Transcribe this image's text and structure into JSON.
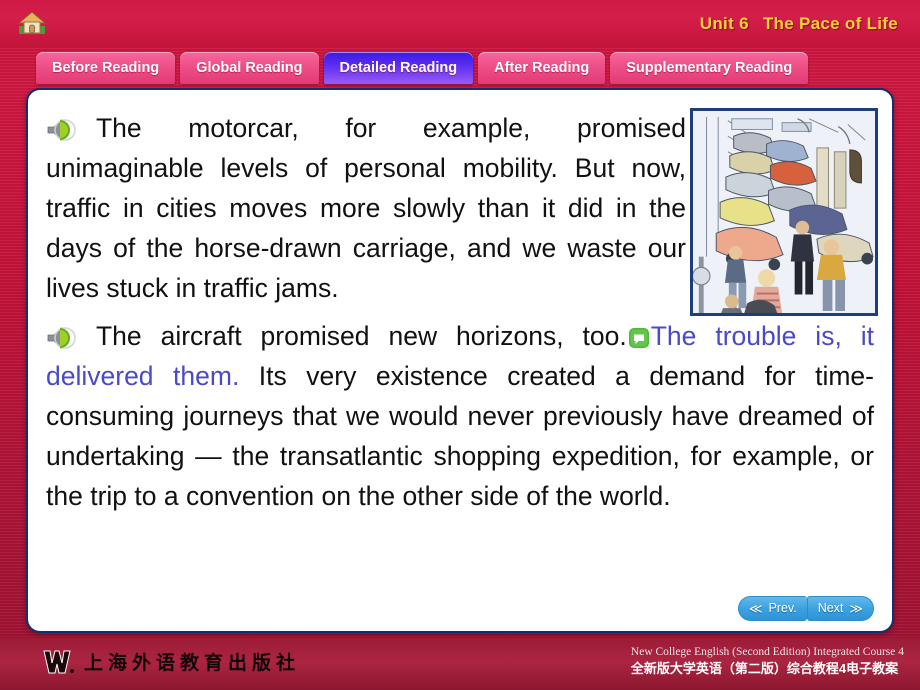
{
  "header": {
    "home_icon": "home-icon",
    "unit_number": "Unit 6",
    "unit_title": "The Pace of Life"
  },
  "tabs": [
    {
      "label": "Before Reading",
      "active": false
    },
    {
      "label": "Global Reading",
      "active": false
    },
    {
      "label": "Detailed Reading",
      "active": true
    },
    {
      "label": "After Reading",
      "active": false
    },
    {
      "label": "Supplementary Reading",
      "active": false
    }
  ],
  "content": {
    "figure_alt": "traffic-jam-illustration",
    "speaker_icon": "speaker-audio-icon",
    "note_icon": "comment-bubble-icon",
    "paragraph1": "The motorcar, for example, promised unimaginable levels of personal mobility. But now, traffic in cities moves more slowly than it did in the days of the horse-drawn carriage, and we waste our lives stuck in traffic jams.",
    "paragraph2_before": "The aircraft promised new horizons, too.",
    "paragraph2_highlight": "The trouble is, it delivered them.",
    "paragraph2_after": " Its very existence created a demand for time-consuming journeys that we would never previously have dreamed of undertaking — the transatlantic shopping expedition, for example, or the trip to a convention on the other side of the world.",
    "highlight_color": "#4a4ac8"
  },
  "nav": {
    "prev_label": "Prev.",
    "next_label": "Next",
    "prev_chevron": "≪",
    "next_chevron": "≫"
  },
  "footer": {
    "publisher_logo": "sflep-w-logo",
    "publisher_name": "上海外语教育出版社",
    "title_en": "New College English (Second Edition) Integrated Course 4",
    "title_cn": "全新版大学英语（第二版）综合教程4电子教案"
  }
}
